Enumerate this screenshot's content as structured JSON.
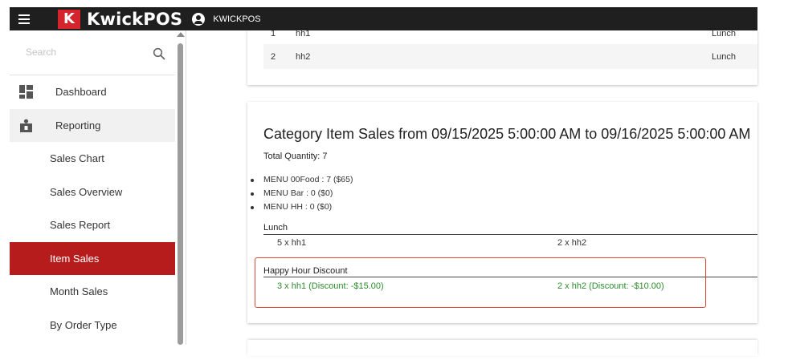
{
  "app": {
    "logo_letter": "K",
    "name": "KwickPOS",
    "user": "KWICKPOS"
  },
  "sidebar": {
    "search_placeholder": "Search",
    "items": [
      {
        "label": "Dashboard",
        "icon": "dashboard-icon"
      },
      {
        "label": "Reporting",
        "icon": "reporting-icon"
      },
      {
        "label": "Sales Chart"
      },
      {
        "label": "Sales Overview"
      },
      {
        "label": "Sales Report"
      },
      {
        "label": "Item Sales",
        "active": true
      },
      {
        "label": "Month Sales"
      },
      {
        "label": "By Order Type"
      }
    ]
  },
  "top_table": {
    "rows": [
      {
        "num": "1",
        "name": "hh1",
        "category": "Lunch"
      },
      {
        "num": "2",
        "name": "hh2",
        "category": "Lunch"
      }
    ]
  },
  "category_sales": {
    "title": "Category Item Sales from 09/15/2025 5:00:00 AM to 09/16/2025 5:00:00 AM",
    "total_quantity": "Total Quantity: 7",
    "menus": [
      "MENU 00Food : 7 ($65)",
      "MENU Bar : 0 ($0)",
      "MENU HH : 0 ($0)"
    ],
    "sections": [
      {
        "title": "Lunch",
        "items": [
          "5 x hh1",
          "2 x hh2"
        ]
      },
      {
        "title": "Happy Hour Discount",
        "items": [
          "3 x hh1 (Discount: -$15.00)",
          "2 x hh2 (Discount: -$10.00)"
        ]
      }
    ]
  },
  "colors": {
    "topbar": "#1f1f1f",
    "brand_red": "#d5242b",
    "active_item": "#b71c1c",
    "discount_green": "#2e8b2e",
    "highlight_border": "#e04a3a"
  }
}
